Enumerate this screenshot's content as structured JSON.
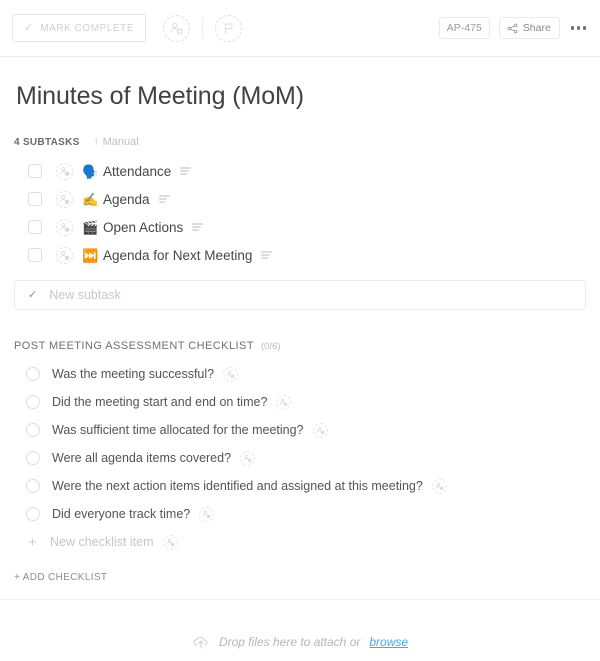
{
  "toolbar": {
    "mark_complete_label": "MARK COMPLETE",
    "mark_complete_icon": "check-icon",
    "assignee_icon": "add-assignee-icon",
    "priority_icon": "flag-icon",
    "task_id": "AP-475",
    "share_label": "Share",
    "share_icon": "share-icon",
    "more_icon": "ellipsis-icon"
  },
  "header": {
    "title": "Minutes of Meeting (MoM)"
  },
  "subtasks_section": {
    "count_label": "4 SUBTASKS",
    "sort_icon": "sort-ascending-icon",
    "sort_label": "Manual",
    "items": [
      {
        "emoji": "🗣️",
        "emoji_name": "speaking-head-emoji",
        "name": "Attendance",
        "checked": false
      },
      {
        "emoji": "✍️",
        "emoji_name": "writing-hand-emoji",
        "name": "Agenda",
        "checked": false
      },
      {
        "emoji": "🎬",
        "emoji_name": "clapper-board-emoji",
        "name": "Open Actions",
        "checked": false
      },
      {
        "emoji": "⏭️",
        "emoji_name": "next-track-emoji",
        "name": "Agenda for Next Meeting",
        "checked": false
      }
    ],
    "new_subtask_placeholder": "New subtask",
    "new_subtask_icon": "check-icon"
  },
  "checklist_section": {
    "title": "POST MEETING ASSESSMENT CHECKLIST",
    "progress": "(0/6)",
    "items": [
      {
        "text": "Was the meeting successful?",
        "checked": false
      },
      {
        "text": "Did the meeting start and end on time?",
        "checked": false
      },
      {
        "text": "Was sufficient time allocated for the meeting?",
        "checked": false
      },
      {
        "text": "Were all agenda items covered?",
        "checked": false
      },
      {
        "text": "Were the next action items identified and assigned at this meeting?",
        "checked": false
      },
      {
        "text": "Did everyone track time?",
        "checked": false
      }
    ],
    "new_item_placeholder": "New checklist item",
    "new_item_icon": "plus-icon",
    "add_checklist_label": "+ ADD CHECKLIST"
  },
  "attachments": {
    "icon": "upload-cloud-icon",
    "drop_text": "Drop files here to attach or",
    "browse_label": "browse"
  },
  "colors": {
    "link_blue": "#3ea8f5",
    "text_primary": "#474747",
    "text_muted": "#c0c0c0",
    "border": "#ececec"
  }
}
